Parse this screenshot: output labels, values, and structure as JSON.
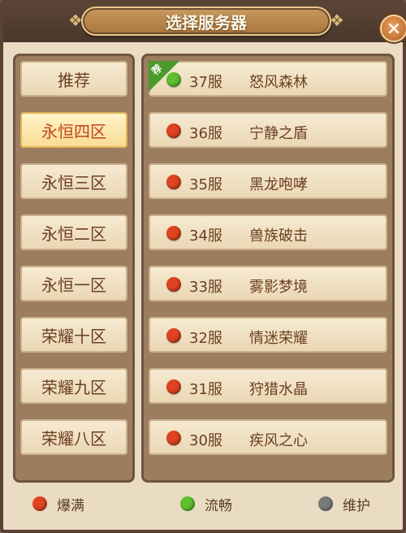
{
  "title": "选择服务器",
  "close_icon": "×",
  "ornament": "❖",
  "recommend_badge": "荐",
  "colors": {
    "full": "#e0431f",
    "smooth": "#5fbf2c",
    "maintenance": "#7a7a7a"
  },
  "zones": [
    {
      "label": "推荐",
      "selected": false
    },
    {
      "label": "永恒四区",
      "selected": true
    },
    {
      "label": "永恒三区",
      "selected": false
    },
    {
      "label": "永恒二区",
      "selected": false
    },
    {
      "label": "永恒一区",
      "selected": false
    },
    {
      "label": "荣耀十区",
      "selected": false
    },
    {
      "label": "荣耀九区",
      "selected": false
    },
    {
      "label": "荣耀八区",
      "selected": false
    }
  ],
  "servers": [
    {
      "num": "37服",
      "name": "怒风森林",
      "status": "smooth",
      "recommended": true
    },
    {
      "num": "36服",
      "name": "宁静之盾",
      "status": "full",
      "recommended": false
    },
    {
      "num": "35服",
      "name": "黑龙咆哮",
      "status": "full",
      "recommended": false
    },
    {
      "num": "34服",
      "name": "兽族破击",
      "status": "full",
      "recommended": false
    },
    {
      "num": "33服",
      "name": "雾影梦境",
      "status": "full",
      "recommended": false
    },
    {
      "num": "32服",
      "name": "情迷荣耀",
      "status": "full",
      "recommended": false
    },
    {
      "num": "31服",
      "name": "狩猎水晶",
      "status": "full",
      "recommended": false
    },
    {
      "num": "30服",
      "name": "疾风之心",
      "status": "full",
      "recommended": false
    }
  ],
  "legend": {
    "full": "爆满",
    "smooth": "流畅",
    "maintenance": "维护"
  }
}
